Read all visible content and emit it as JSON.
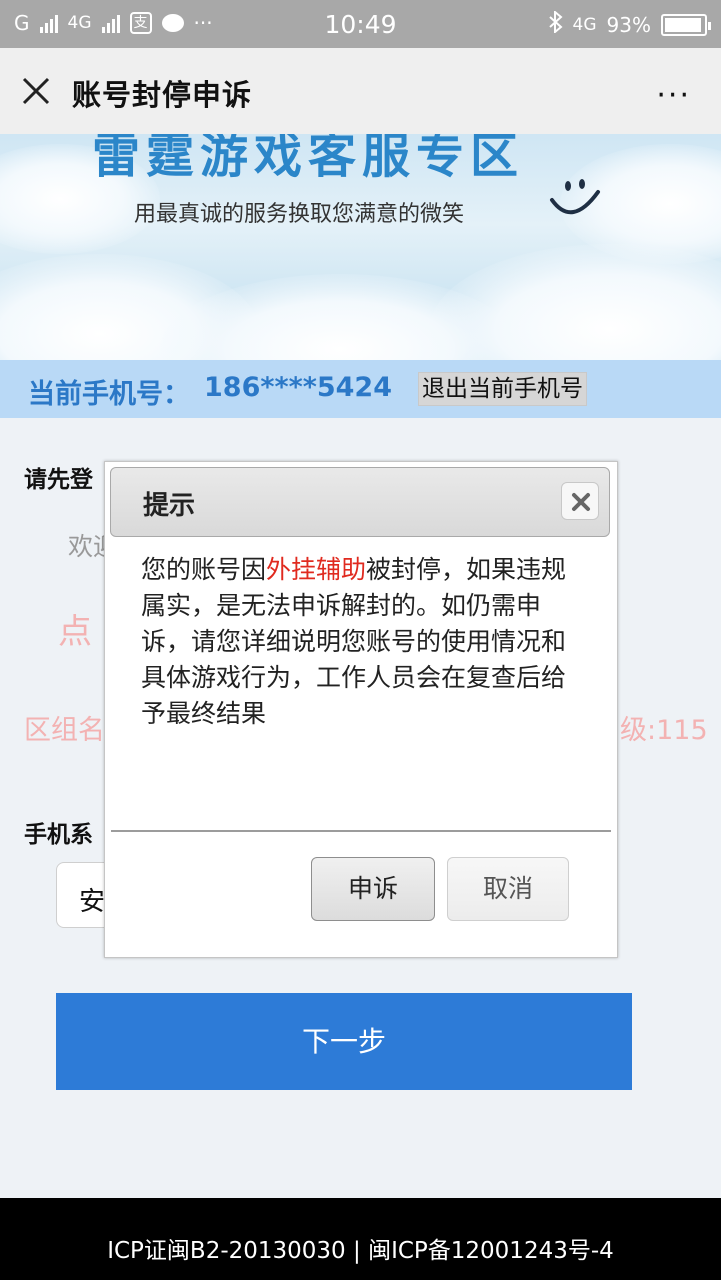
{
  "status_bar": {
    "carrier_left": "G",
    "network_left": "4G",
    "time": "10:49",
    "network_right": "4G",
    "battery": "93%"
  },
  "nav": {
    "title": "账号封停申诉",
    "more": "···"
  },
  "banner": {
    "title": "雷霆游戏客服专区",
    "subtitle": "用最真诚的服务换取您满意的微笑"
  },
  "phone_bar": {
    "label": "当前手机号：",
    "number": "186****5424",
    "logout_label": "退出当前手机号"
  },
  "background": {
    "login_prompt": "请先登",
    "welcome": "欢迎",
    "red_text": "点",
    "zone_label": "区组名",
    "level_label": "级:115",
    "system_label": "手机系",
    "system_value": "安"
  },
  "next_button": "下一步",
  "footer": {
    "text": "ICP证闽B2-20130030 | 闽ICP备12001243号-4"
  },
  "dialog": {
    "title": "提示",
    "message_before": "您的账号因",
    "message_highlight": "外挂辅助",
    "message_after": "被封停，如果违规属实，是无法申诉解封的。如仍需申诉，请您详细说明您账号的使用情况和具体游戏行为，工作人员会在复查后给予最终结果",
    "appeal_button": "申诉",
    "cancel_button": "取消"
  },
  "colors": {
    "accent": "#2d7bd7",
    "highlight": "#e02a1f",
    "phone_bar": "#b9d9f6"
  }
}
